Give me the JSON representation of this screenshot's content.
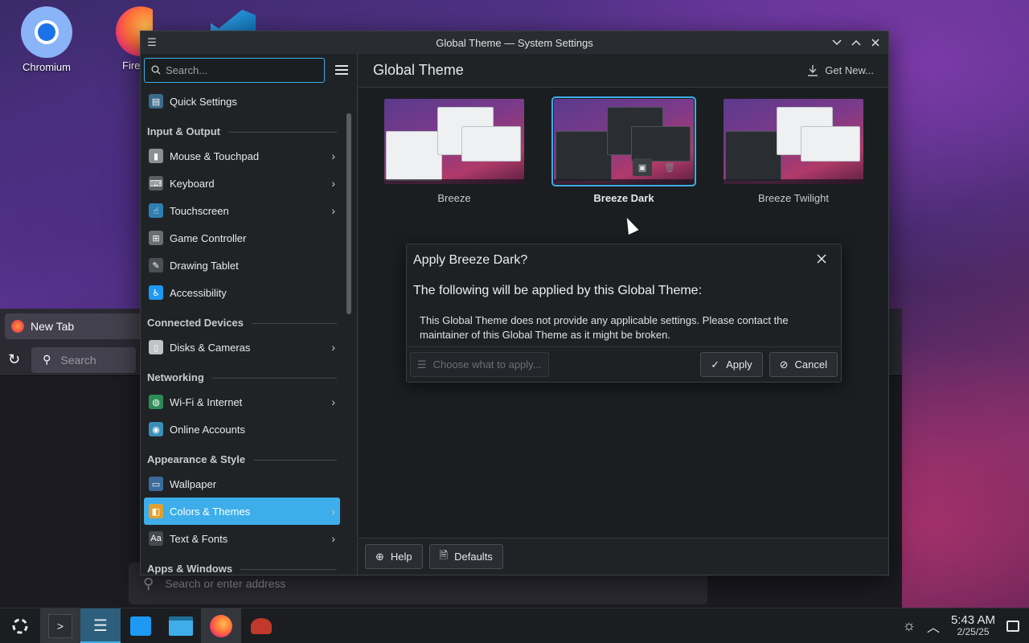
{
  "desktop": {
    "icons": [
      {
        "label": "Chromium"
      },
      {
        "label": "Fire"
      },
      {
        "label": ""
      }
    ]
  },
  "background_browser": {
    "tab_label": "New Tab",
    "search_placeholder": "Search",
    "url_placeholder": "Search or enter address"
  },
  "window": {
    "title": "Global Theme — System Settings"
  },
  "sidebar": {
    "search_placeholder": "Search...",
    "items": [
      {
        "type": "item",
        "label": "Quick Settings",
        "icon": "quick-settings-icon",
        "chevron": false
      },
      {
        "type": "section",
        "label": "Input & Output"
      },
      {
        "type": "item",
        "label": "Mouse & Touchpad",
        "icon": "mouse-icon",
        "chevron": true
      },
      {
        "type": "item",
        "label": "Keyboard",
        "icon": "keyboard-icon",
        "chevron": true
      },
      {
        "type": "item",
        "label": "Touchscreen",
        "icon": "touchscreen-icon",
        "chevron": true
      },
      {
        "type": "item",
        "label": "Game Controller",
        "icon": "gamepad-icon",
        "chevron": false
      },
      {
        "type": "item",
        "label": "Drawing Tablet",
        "icon": "tablet-icon",
        "chevron": false
      },
      {
        "type": "item",
        "label": "Accessibility",
        "icon": "accessibility-icon",
        "chevron": false
      },
      {
        "type": "section",
        "label": "Connected Devices"
      },
      {
        "type": "item",
        "label": "Disks & Cameras",
        "icon": "disk-icon",
        "chevron": true
      },
      {
        "type": "section",
        "label": "Networking"
      },
      {
        "type": "item",
        "label": "Wi-Fi & Internet",
        "icon": "globe-icon",
        "chevron": true
      },
      {
        "type": "item",
        "label": "Online Accounts",
        "icon": "accounts-icon",
        "chevron": false
      },
      {
        "type": "section",
        "label": "Appearance & Style"
      },
      {
        "type": "item",
        "label": "Wallpaper",
        "icon": "wallpaper-icon",
        "chevron": false
      },
      {
        "type": "item",
        "label": "Colors & Themes",
        "icon": "colors-icon",
        "chevron": true,
        "active": true
      },
      {
        "type": "item",
        "label": "Text & Fonts",
        "icon": "fonts-icon",
        "chevron": true
      },
      {
        "type": "section",
        "label": "Apps & Windows"
      }
    ]
  },
  "content": {
    "title": "Global Theme",
    "get_new_label": "Get New...",
    "themes": [
      {
        "label": "Breeze",
        "variant": "light",
        "selected": false
      },
      {
        "label": "Breeze Dark",
        "variant": "dark",
        "selected": true
      },
      {
        "label": "Breeze Twilight",
        "variant": "twilight",
        "selected": false
      }
    ],
    "help_label": "Help",
    "defaults_label": "Defaults"
  },
  "dialog": {
    "title": "Apply Breeze Dark?",
    "heading": "The following will be applied by this Global Theme:",
    "body": "This Global Theme does not provide any applicable settings. Please contact the maintainer of this Global Theme as it might be broken.",
    "choose_label": "Choose what to apply...",
    "apply_label": "Apply",
    "cancel_label": "Cancel"
  },
  "taskbar": {
    "time": "5:43 AM",
    "date": "2/25/25"
  },
  "colors": {
    "accent": "#3daee9",
    "window_bg": "#202326",
    "panel_bg": "#1b1d21"
  }
}
